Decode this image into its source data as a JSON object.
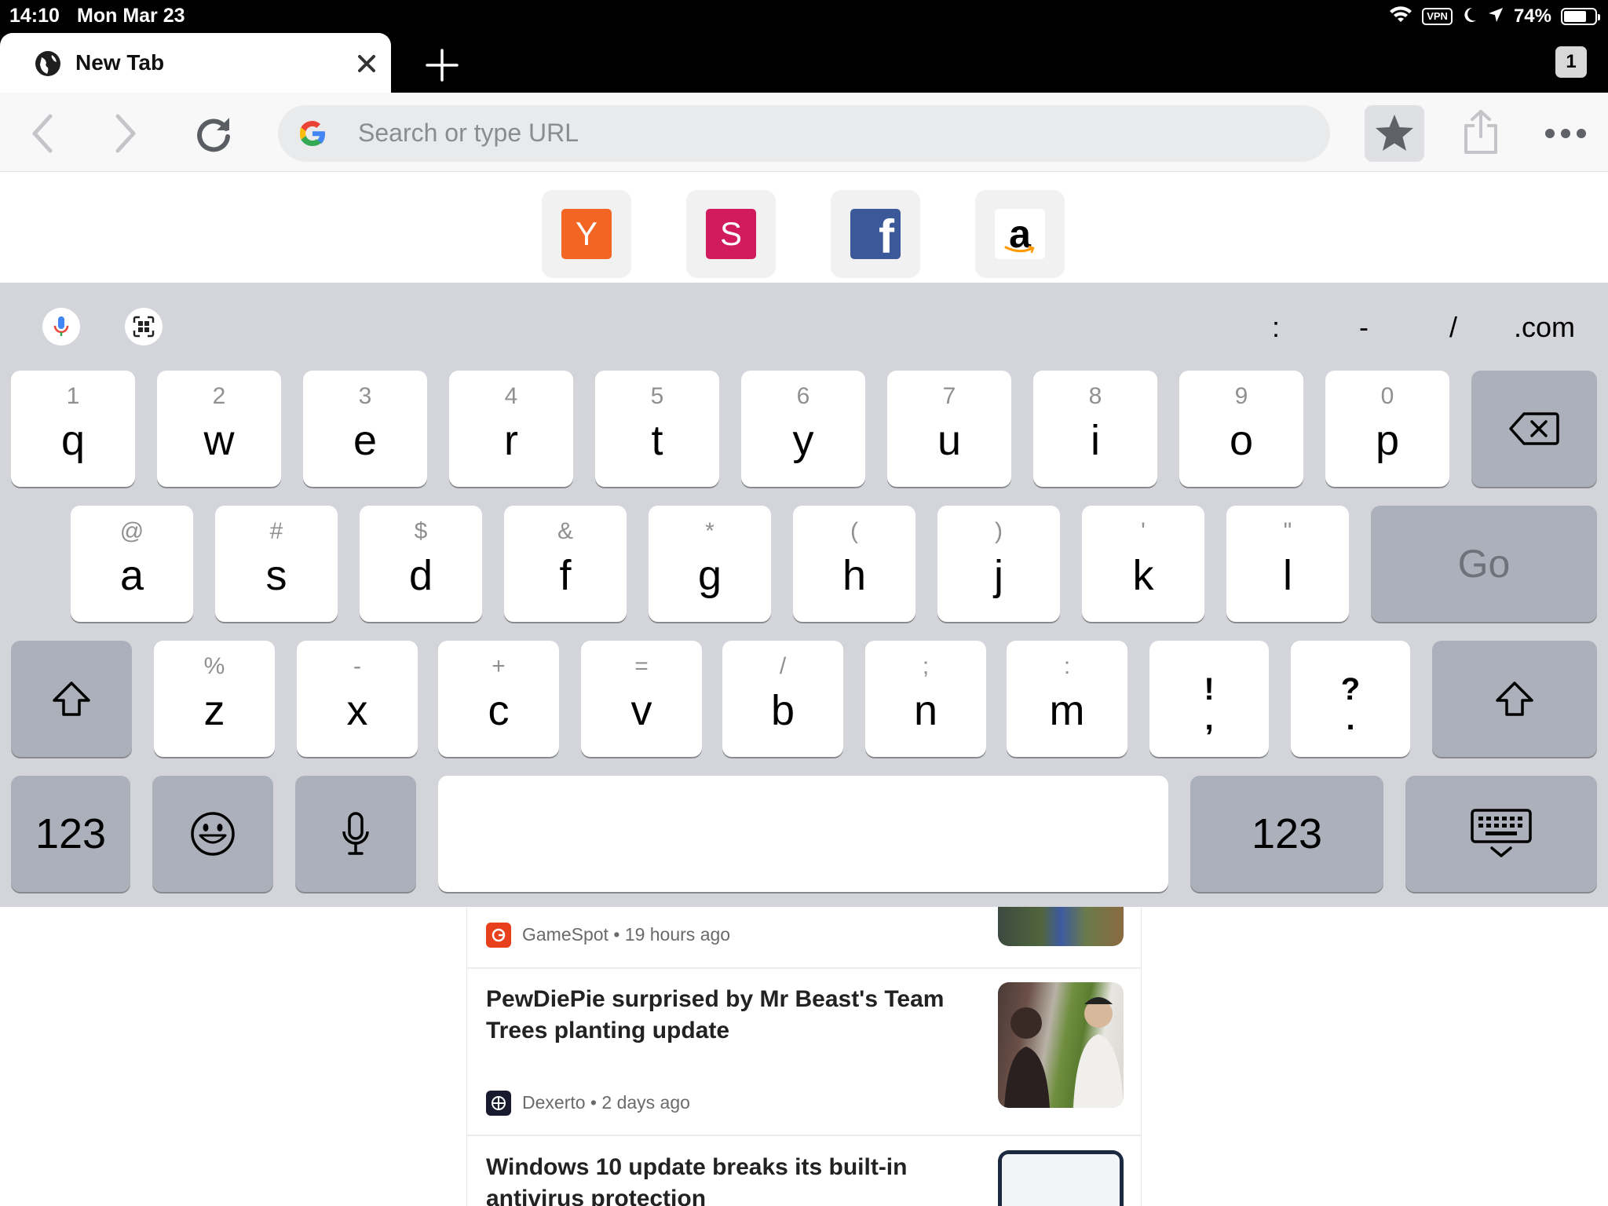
{
  "status_bar": {
    "time": "14:10",
    "date": "Mon Mar 23",
    "vpn": "VPN",
    "battery": "74%"
  },
  "tab": {
    "title": "New Tab",
    "count": "1"
  },
  "toolbar": {
    "search_placeholder": "Search or type URL"
  },
  "shortcuts": [
    {
      "letter": "Y",
      "color": "#f26522"
    },
    {
      "letter": "S",
      "color": "#d11b5d"
    },
    {
      "letter": "f",
      "color": "#3b5998"
    },
    {
      "letter": "a",
      "color": "#ffffff"
    }
  ],
  "keyboard": {
    "symbols": [
      ":",
      "-",
      "/",
      ".com"
    ],
    "row1": {
      "keys": [
        "q",
        "w",
        "e",
        "r",
        "t",
        "y",
        "u",
        "i",
        "o",
        "p"
      ],
      "subs": [
        "1",
        "2",
        "3",
        "4",
        "5",
        "6",
        "7",
        "8",
        "9",
        "0"
      ]
    },
    "row2": {
      "keys": [
        "a",
        "s",
        "d",
        "f",
        "g",
        "h",
        "j",
        "k",
        "l"
      ],
      "subs": [
        "@",
        "#",
        "$",
        "&",
        "*",
        "(",
        ")",
        "'",
        "\""
      ],
      "go": "Go"
    },
    "row3": {
      "keys": [
        "z",
        "x",
        "c",
        "v",
        "b",
        "n",
        "m"
      ],
      "subs": [
        "%",
        "-",
        "+",
        "=",
        "/",
        ";",
        ":"
      ],
      "punct": [
        {
          "top": "!",
          "bottom": ","
        },
        {
          "top": "?",
          "bottom": "."
        }
      ]
    },
    "bottom": {
      "numbers_left": "123",
      "numbers_right": "123"
    }
  },
  "feed": {
    "items": [
      {
        "headline": "",
        "source": "GameSpot",
        "age": "19 hours ago"
      },
      {
        "headline": "PewDiePie surprised by Mr Beast's Team Trees planting update",
        "source": "Dexerto",
        "age": "2 days ago"
      },
      {
        "headline": "Windows 10 update breaks its built-in antivirus protection",
        "source": "",
        "age": ""
      }
    ]
  },
  "colors": {
    "keyboard_bg": "#d3d5db",
    "dark_key": "#abb0ba",
    "gamespot": "#e8401c"
  }
}
